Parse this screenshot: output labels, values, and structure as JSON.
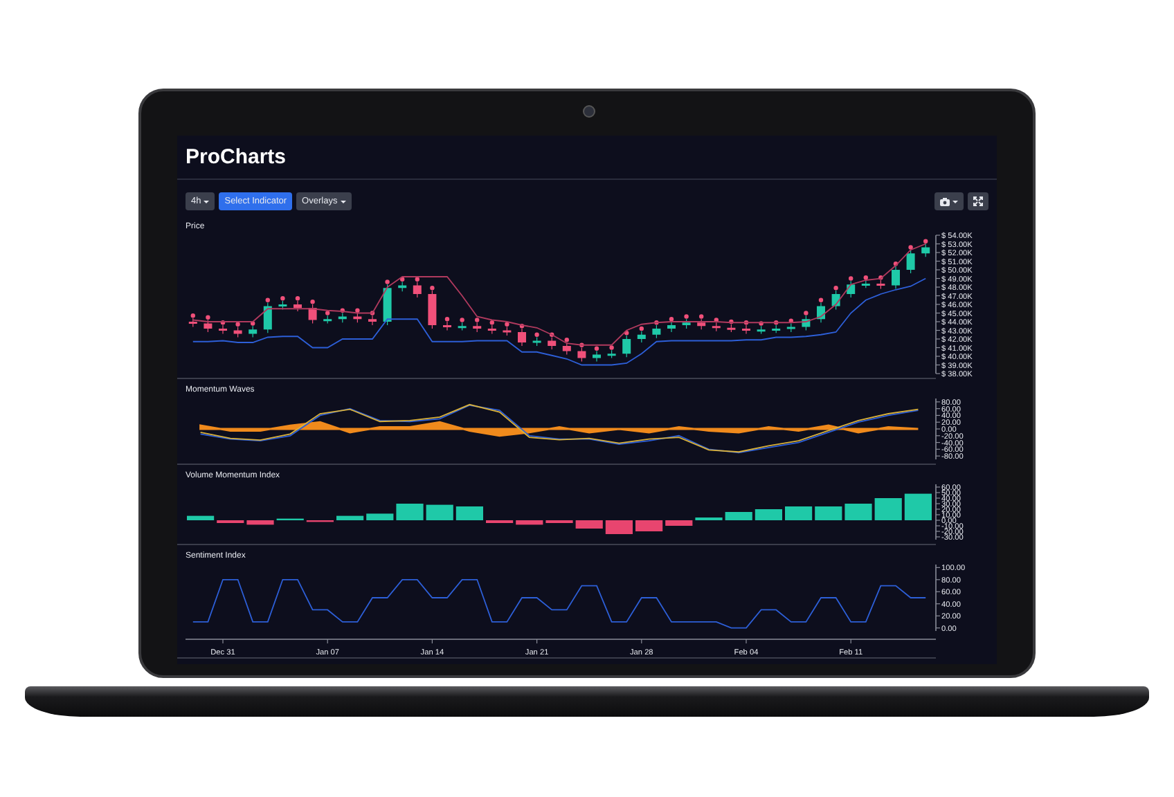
{
  "app": {
    "title": "ProCharts"
  },
  "toolbar": {
    "buttons": [
      {
        "label": "4h",
        "kind": "dropdown",
        "selected": false
      },
      {
        "label": "Select Indicator",
        "kind": "plain",
        "selected": true
      },
      {
        "label": "Overlays",
        "kind": "dropdown",
        "selected": false
      }
    ],
    "tools": [
      {
        "kind": "camera"
      },
      {
        "kind": "expand"
      }
    ]
  },
  "panels": [
    {
      "chart_data": {
        "type": "candlestick",
        "title": "Price",
        "categories": [
          null,
          null,
          null,
          null,
          null,
          null,
          null,
          null,
          null,
          null,
          null,
          null,
          null,
          null,
          null,
          null,
          null,
          null,
          null,
          null,
          null,
          null,
          null,
          null,
          null,
          null,
          null,
          null,
          null,
          null,
          null,
          null,
          null,
          null,
          null,
          null,
          null,
          null,
          null,
          null,
          null,
          null,
          null,
          null,
          null,
          null,
          null,
          null,
          null,
          null
        ],
        "ylim": [
          38,
          54
        ],
        "yticks": [
          {
            "value": 54,
            "label": "$ 54.00K"
          },
          {
            "value": 53,
            "label": "$ 53.00K"
          },
          {
            "value": 52,
            "label": "$ 52.00K"
          },
          {
            "value": 51,
            "label": "$ 51.00K"
          },
          {
            "value": 50,
            "label": "$ 50.00K"
          },
          {
            "value": 49,
            "label": "$ 49.00K"
          },
          {
            "value": 48,
            "label": "$ 48.00K"
          },
          {
            "value": 47,
            "label": "$ 47.00K"
          },
          {
            "value": 46,
            "label": "$ 46.00K"
          },
          {
            "value": 45,
            "label": "$ 45.00K"
          },
          {
            "value": 44,
            "label": "$ 44.00K"
          },
          {
            "value": 43,
            "label": "$ 43.00K"
          },
          {
            "value": 42,
            "label": "$ 42.00K"
          },
          {
            "value": 41,
            "label": "$ 41.00K"
          },
          {
            "value": 40,
            "label": "$ 40.00K"
          },
          {
            "value": 39,
            "label": "$ 39.00K"
          },
          {
            "value": 38,
            "label": "$ 38.00K"
          }
        ],
        "ohlc": [
          [
            44.0,
            44.4,
            43.4,
            43.8
          ],
          [
            43.8,
            44.2,
            42.8,
            43.2
          ],
          [
            43.2,
            43.6,
            42.6,
            43.0
          ],
          [
            43.0,
            43.4,
            42.2,
            42.6
          ],
          [
            42.6,
            43.5,
            42.2,
            43.1
          ],
          [
            43.1,
            46.2,
            42.7,
            45.8
          ],
          [
            45.8,
            46.4,
            45.4,
            46.0
          ],
          [
            46.0,
            46.4,
            45.2,
            45.6
          ],
          [
            45.6,
            46.0,
            43.8,
            44.2
          ],
          [
            44.2,
            44.7,
            43.8,
            44.3
          ],
          [
            44.3,
            45.0,
            43.9,
            44.6
          ],
          [
            44.6,
            45.0,
            43.9,
            44.3
          ],
          [
            44.3,
            44.7,
            43.6,
            44.0
          ],
          [
            44.0,
            48.3,
            43.6,
            47.9
          ],
          [
            47.9,
            48.6,
            47.5,
            48.2
          ],
          [
            48.2,
            48.6,
            46.8,
            47.2
          ],
          [
            47.2,
            47.6,
            43.2,
            43.6
          ],
          [
            43.6,
            44.0,
            43.0,
            43.4
          ],
          [
            43.4,
            43.9,
            43.0,
            43.5
          ],
          [
            43.5,
            43.9,
            42.8,
            43.2
          ],
          [
            43.2,
            43.6,
            42.6,
            43.0
          ],
          [
            43.0,
            43.4,
            42.4,
            42.8
          ],
          [
            42.8,
            43.2,
            41.2,
            41.6
          ],
          [
            41.6,
            42.2,
            41.2,
            41.8
          ],
          [
            41.8,
            42.2,
            40.8,
            41.2
          ],
          [
            41.2,
            41.6,
            40.2,
            40.6
          ],
          [
            40.6,
            41.0,
            39.4,
            39.8
          ],
          [
            39.8,
            40.6,
            39.4,
            40.2
          ],
          [
            40.2,
            40.7,
            39.8,
            40.3
          ],
          [
            40.3,
            42.4,
            39.9,
            42.0
          ],
          [
            42.0,
            42.9,
            41.6,
            42.5
          ],
          [
            42.5,
            43.6,
            42.1,
            43.2
          ],
          [
            43.2,
            44.0,
            42.8,
            43.6
          ],
          [
            43.6,
            44.3,
            43.2,
            43.9
          ],
          [
            43.9,
            44.3,
            43.1,
            43.5
          ],
          [
            43.5,
            43.9,
            42.9,
            43.3
          ],
          [
            43.3,
            43.7,
            42.8,
            43.2
          ],
          [
            43.2,
            43.6,
            42.6,
            43.0
          ],
          [
            43.0,
            43.5,
            42.6,
            43.1
          ],
          [
            43.1,
            43.6,
            42.7,
            43.2
          ],
          [
            43.2,
            43.8,
            42.8,
            43.4
          ],
          [
            43.4,
            44.7,
            43.0,
            44.3
          ],
          [
            44.3,
            46.2,
            43.9,
            45.8
          ],
          [
            45.8,
            47.6,
            45.4,
            47.2
          ],
          [
            47.2,
            48.7,
            46.8,
            48.3
          ],
          [
            48.3,
            48.8,
            47.9,
            48.4
          ],
          [
            48.4,
            48.8,
            47.8,
            48.2
          ],
          [
            48.2,
            50.4,
            47.8,
            50.0
          ],
          [
            50.0,
            52.3,
            49.6,
            51.9
          ],
          [
            51.9,
            53.0,
            51.5,
            52.6
          ]
        ],
        "series": [
          {
            "type": "scatter",
            "color": "#f0507a",
            "values": [
              44.7,
              44.5,
              43.9,
              43.7,
              43.8,
              46.5,
              46.7,
              46.7,
              46.3,
              45.0,
              45.3,
              45.3,
              45.0,
              48.6,
              48.9,
              48.9,
              47.9,
              44.3,
              44.2,
              44.2,
              43.9,
              43.7,
              43.5,
              42.5,
              42.5,
              41.9,
              41.3,
              40.9,
              41.0,
              42.7,
              43.2,
              43.9,
              44.3,
              44.6,
              44.6,
              44.2,
              44.0,
              43.9,
              43.8,
              43.9,
              44.1,
              45.0,
              46.5,
              47.9,
              49.0,
              49.1,
              49.1,
              50.7,
              52.6,
              53.3
            ]
          },
          {
            "type": "line",
            "color": "#b03a5e",
            "values": [
              44.2,
              44.0,
              44.0,
              44.0,
              44.0,
              45.5,
              45.5,
              45.5,
              45.5,
              45.3,
              45.2,
              45.0,
              45.0,
              48.0,
              49.2,
              49.2,
              49.2,
              49.2,
              47.0,
              44.6,
              44.2,
              44.0,
              43.6,
              43.3,
              42.5,
              41.5,
              41.3,
              41.3,
              41.3,
              43.0,
              43.7,
              43.9,
              44.0,
              44.0,
              44.0,
              44.0,
              43.9,
              43.9,
              43.9,
              43.9,
              43.9,
              44.0,
              44.6,
              46.0,
              48.3,
              48.8,
              49.0,
              50.5,
              52.3,
              53.0
            ]
          },
          {
            "type": "line",
            "color": "#2d5fd8",
            "values": [
              41.7,
              41.7,
              41.8,
              41.6,
              41.6,
              42.2,
              42.3,
              42.3,
              41.0,
              41.0,
              42.0,
              42.0,
              42.0,
              44.3,
              44.3,
              44.3,
              41.7,
              41.7,
              41.7,
              41.8,
              41.8,
              41.8,
              40.5,
              40.5,
              40.1,
              39.7,
              39.0,
              39.0,
              39.0,
              39.2,
              40.3,
              41.7,
              41.8,
              41.8,
              41.8,
              41.8,
              41.8,
              41.9,
              41.9,
              42.2,
              42.2,
              42.3,
              42.5,
              42.8,
              45.0,
              46.5,
              47.2,
              47.7,
              48.1,
              49.0
            ]
          }
        ]
      }
    },
    {
      "chart_data": {
        "type": "line",
        "title": "Momentum Waves",
        "categories": [
          null,
          null,
          null,
          null,
          null,
          null,
          null,
          null,
          null,
          null,
          null,
          null,
          null,
          null,
          null,
          null,
          null,
          null,
          null,
          null,
          null,
          null,
          null,
          null,
          null
        ],
        "ylim": [
          -90,
          90
        ],
        "yticks": [
          {
            "value": 80,
            "label": "80.00"
          },
          {
            "value": 60,
            "label": "60.00"
          },
          {
            "value": 40,
            "label": "40.00"
          },
          {
            "value": 20,
            "label": "20.00"
          },
          {
            "value": 0,
            "label": "0.00"
          },
          {
            "value": -20,
            "label": "-20.00"
          },
          {
            "value": -40,
            "label": "-40.00"
          },
          {
            "value": -60,
            "label": "-60.00"
          },
          {
            "value": -80,
            "label": "-80.00"
          }
        ],
        "series": [
          {
            "type": "area",
            "color": "#f08a1c",
            "values": [
              10,
              -5,
              -5,
              10,
              20,
              -10,
              5,
              5,
              20,
              -5,
              -20,
              -10,
              5,
              -10,
              0,
              -10,
              5,
              -5,
              -10,
              5,
              -5,
              10,
              -10,
              5,
              0
            ]
          },
          {
            "type": "line",
            "color": "#2d5fd8",
            "values": [
              -15,
              -30,
              -35,
              -20,
              40,
              60,
              25,
              22,
              30,
              70,
              55,
              -20,
              -30,
              -30,
              -45,
              -35,
              -20,
              -60,
              -70,
              -55,
              -40,
              -10,
              20,
              40,
              55
            ]
          },
          {
            "type": "line",
            "color": "#d9b13a",
            "values": [
              -10,
              -28,
              -33,
              -15,
              45,
              58,
              22,
              25,
              35,
              72,
              50,
              -25,
              -32,
              -28,
              -42,
              -30,
              -25,
              -62,
              -68,
              -50,
              -35,
              -5,
              25,
              45,
              58
            ]
          }
        ]
      }
    },
    {
      "chart_data": {
        "type": "bar",
        "title": "Volume Momentum Index",
        "categories": [
          null,
          null,
          null,
          null,
          null,
          null,
          null,
          null,
          null,
          null,
          null,
          null,
          null,
          null,
          null,
          null,
          null,
          null,
          null,
          null,
          null,
          null,
          null,
          null,
          null
        ],
        "ylim": [
          -35,
          65
        ],
        "yticks": [
          {
            "value": 60,
            "label": "60.00"
          },
          {
            "value": 50,
            "label": "50.00"
          },
          {
            "value": 40,
            "label": "40.00"
          },
          {
            "value": 30,
            "label": "30.00"
          },
          {
            "value": 20,
            "label": "20.00"
          },
          {
            "value": 10,
            "label": "10.00"
          },
          {
            "value": 0,
            "label": "0.00"
          },
          {
            "value": -10,
            "label": "-10.00"
          },
          {
            "value": -20,
            "label": "-20.00"
          },
          {
            "value": -30,
            "label": "-30.00"
          }
        ],
        "series": [
          {
            "color": "#1fc9a8",
            "values": [
              8,
              null,
              null,
              3,
              null,
              8,
              12,
              30,
              28,
              25,
              null,
              null,
              null,
              null,
              null,
              null,
              null,
              5,
              15,
              20,
              25,
              25,
              30,
              40,
              48
            ]
          },
          {
            "color": "#e8456f",
            "values": [
              null,
              -5,
              -8,
              null,
              -3,
              null,
              null,
              null,
              null,
              null,
              -5,
              -8,
              -5,
              -15,
              -25,
              -20,
              -10,
              null,
              null,
              null,
              null,
              null,
              null,
              null,
              null
            ]
          }
        ]
      }
    },
    {
      "chart_data": {
        "type": "line",
        "title": "Sentiment Index",
        "ylim": [
          -5,
          105
        ],
        "categories": [
          null,
          null,
          "Dec 31",
          null,
          null,
          null,
          null,
          null,
          null,
          "Jan 07",
          null,
          null,
          null,
          null,
          null,
          null,
          "Jan 14",
          null,
          null,
          null,
          null,
          null,
          null,
          "Jan 21",
          null,
          null,
          null,
          null,
          null,
          null,
          "Jan 28",
          null,
          null,
          null,
          null,
          null,
          null,
          "Feb 04",
          null,
          null,
          null,
          null,
          null,
          null,
          "Feb 11",
          null,
          null,
          null,
          null,
          null
        ],
        "yticks": [
          {
            "value": 100,
            "label": "100.00"
          },
          {
            "value": 80,
            "label": "80.00"
          },
          {
            "value": 60,
            "label": "60.00"
          },
          {
            "value": 40,
            "label": "40.00"
          },
          {
            "value": 20,
            "label": "20.00"
          },
          {
            "value": 0,
            "label": "0.00"
          }
        ],
        "series": [
          {
            "color": "#2d5fd8",
            "values": [
              10,
              10,
              80,
              80,
              10,
              10,
              80,
              80,
              30,
              30,
              10,
              10,
              50,
              50,
              80,
              80,
              50,
              50,
              80,
              80,
              10,
              10,
              50,
              50,
              30,
              30,
              70,
              70,
              10,
              10,
              50,
              50,
              10,
              10,
              10,
              10,
              0,
              0,
              30,
              30,
              10,
              10,
              50,
              50,
              10,
              10,
              70,
              70,
              50,
              50
            ]
          }
        ]
      }
    }
  ]
}
